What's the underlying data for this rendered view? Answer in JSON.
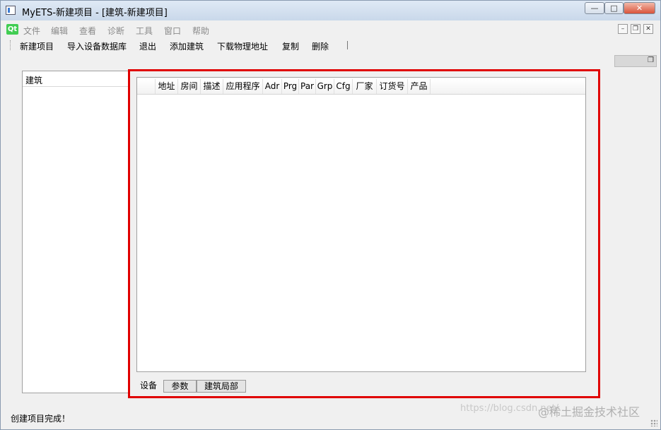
{
  "window": {
    "title": "MyETS-新建项目 - [建筑-新建项目]",
    "controls": {
      "minimize": "—",
      "maximize": "□",
      "close": "✕"
    }
  },
  "menubar": {
    "logo": "Qt",
    "items": [
      "文件",
      "编辑",
      "查看",
      "诊断",
      "工具",
      "窗口",
      "帮助"
    ],
    "mdi_controls": {
      "minimize": "–",
      "restore": "❐",
      "close": "✕"
    }
  },
  "toolbar": {
    "items": [
      "新建项目",
      "导入设备数据库",
      "退出",
      "添加建筑",
      "下载物理地址",
      "复制",
      "删除"
    ]
  },
  "left_panel": {
    "header": "建筑"
  },
  "table": {
    "columns": [
      "",
      "地址",
      "房间",
      "描述",
      "应用程序",
      "Adr",
      "Prg",
      "Par",
      "Grp",
      "Cfg",
      "厂家",
      "订货号",
      "产品"
    ]
  },
  "bottom_tabs": [
    "设备",
    "参数",
    "建筑局部"
  ],
  "active_tab_index": 0,
  "statusbar": {
    "text": "创建项目完成！"
  },
  "watermark": {
    "url": "https://blog.csdn.net/...",
    "brand": "@稀土掘金技术社区"
  },
  "colors": {
    "highlight_frame": "#e00000",
    "qt_green": "#41cd52"
  }
}
